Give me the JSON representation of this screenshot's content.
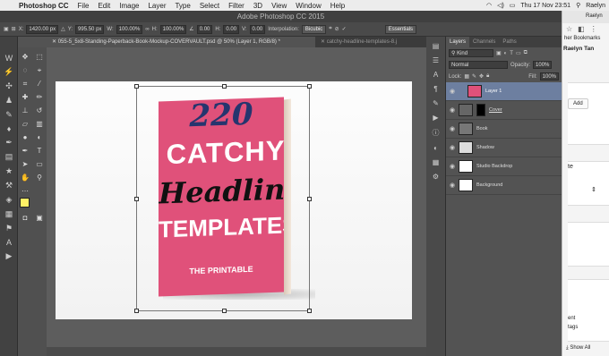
{
  "menubar": {
    "app_name": "Photoshop CC",
    "items": [
      "File",
      "Edit",
      "Image",
      "Layer",
      "Type",
      "Select",
      "Filter",
      "3D",
      "View",
      "Window",
      "Help"
    ],
    "clock": "Thu 17 Nov 23:51",
    "user": "Raelyn"
  },
  "window": {
    "title": "Adobe Photoshop CC 2015"
  },
  "options": {
    "x": "1420.00 px",
    "y": "995.50 px",
    "w": "100.00%",
    "h": "100.00%",
    "angle": "0.00",
    "hskew": "0.00",
    "vskew": "0.00",
    "interpolation_label": "Interpolation:",
    "interpolation": "Bicubic",
    "workspace": "Essentials"
  },
  "tabs": [
    {
      "label": "055-5_5x8-Standing-Paperback-Book-Mockup-COVERVAULT.psd @ 50% (Layer 1, RGB/8) *",
      "active": true
    },
    {
      "label": "catchy-headline-templates-8.j",
      "active": false
    }
  ],
  "book": {
    "line1": "220",
    "line2": "CATCHY",
    "line3": "Headline",
    "line4": "TEMPLATES",
    "line5": "THE PRINTABLE"
  },
  "panel": {
    "tabs": [
      "Layers",
      "Channels",
      "Paths"
    ],
    "kind": "Kind",
    "blend_mode": "Normal",
    "opacity_label": "Opacity:",
    "opacity": "100%",
    "lock_label": "Lock:",
    "fill_label": "Fill:",
    "fill": "100%",
    "layers": [
      "Layer 1",
      "Cover",
      "Book",
      "Shadow",
      "Studio Backdrop",
      "Background"
    ]
  },
  "browser": {
    "profile": "Raelyn",
    "bookmarks": "her Bookmarks",
    "account": "Raelyn Tan",
    "add_button": "Add",
    "section_letter": "te",
    "snippet1": "ent",
    "snippet2": "tags",
    "show_all": "Show All"
  },
  "colors": {
    "foreground": "#fff066",
    "background": "#e8587a",
    "book": "#e0517a",
    "headline_navy": "#26356e"
  }
}
